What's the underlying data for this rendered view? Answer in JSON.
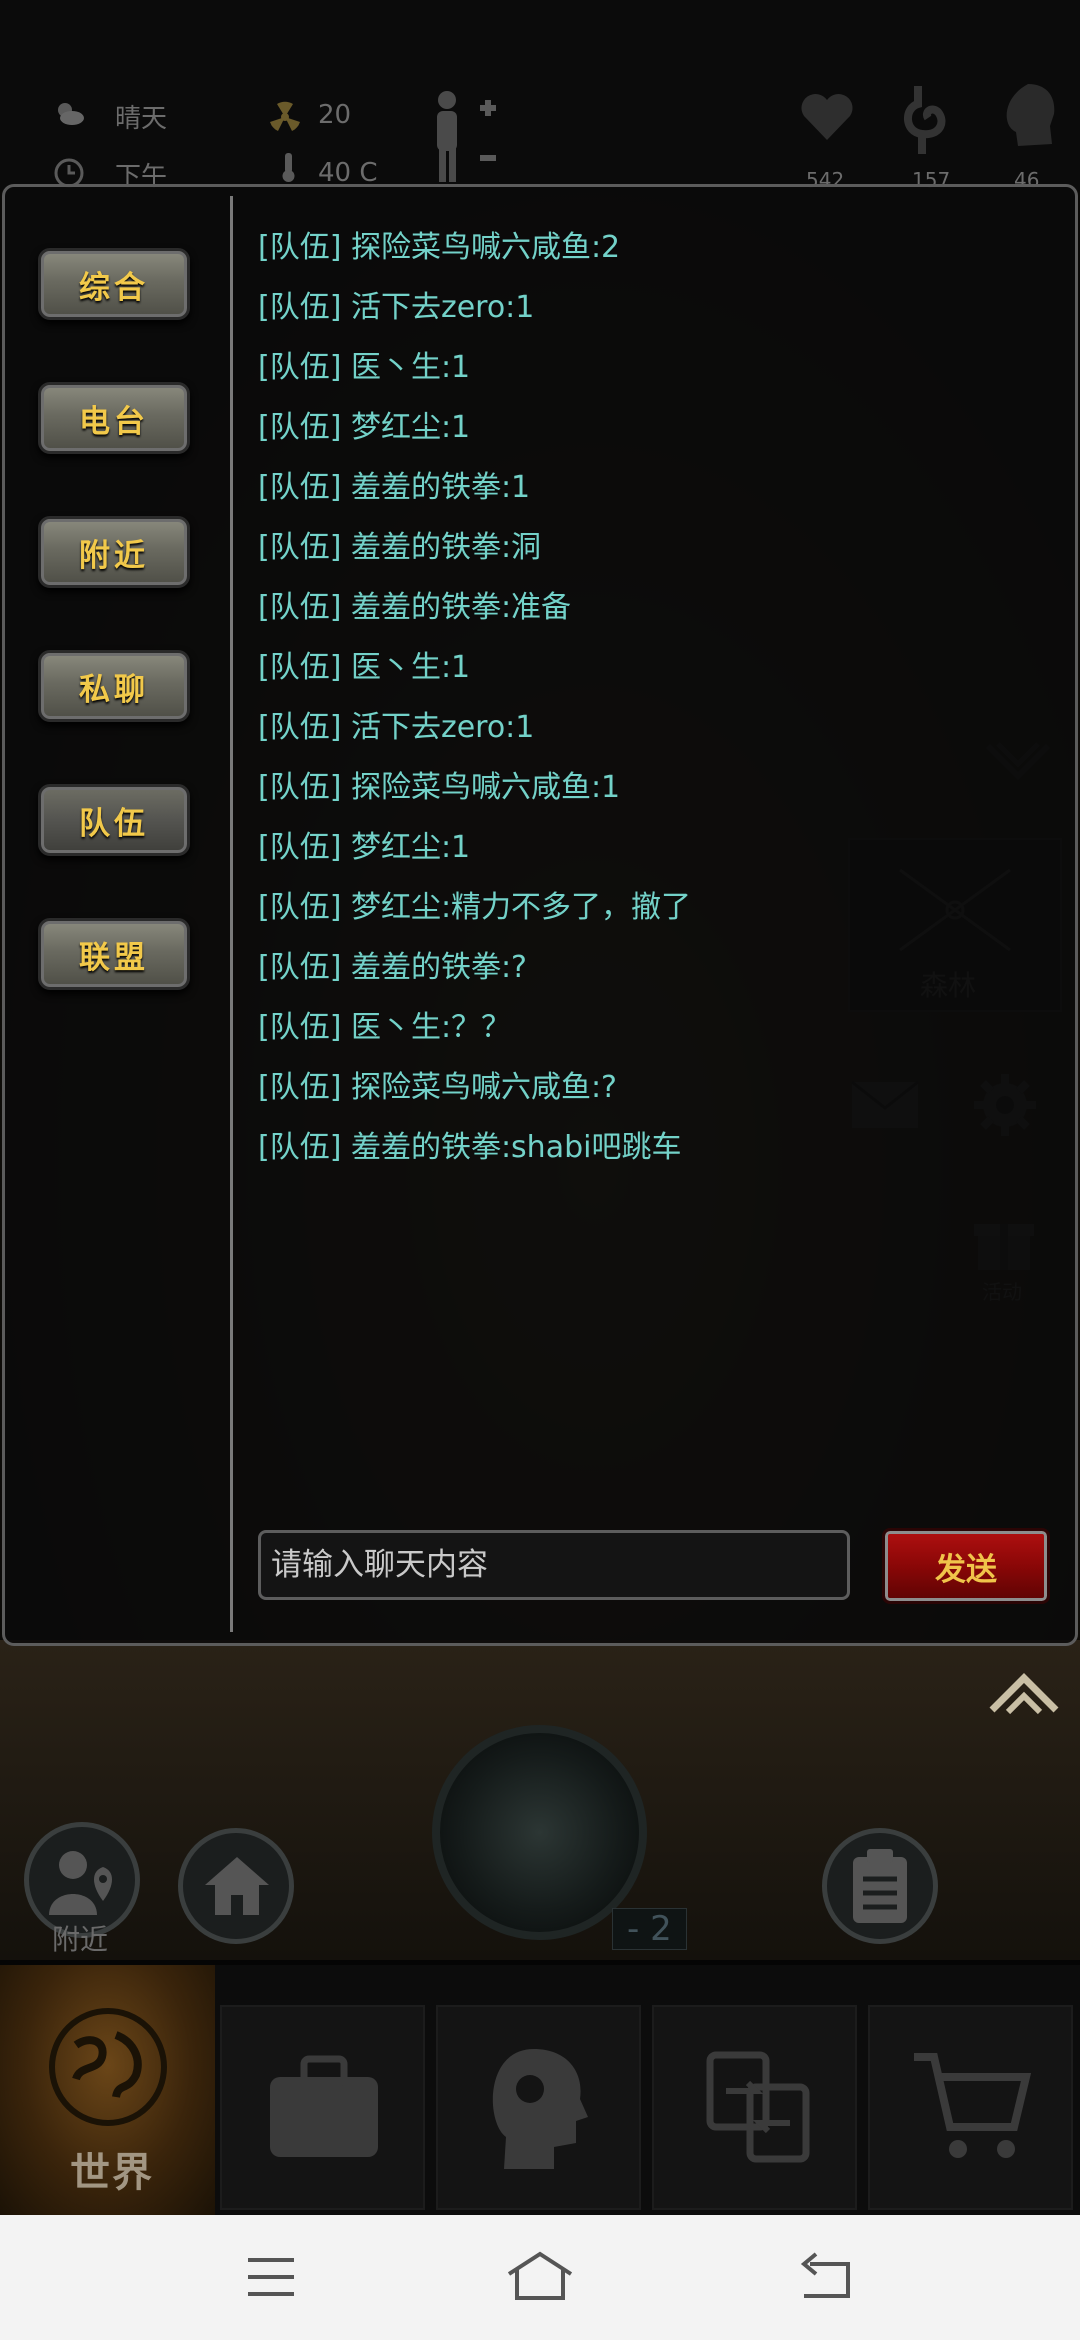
{
  "status": {
    "weather": "晴天",
    "radiation": "20",
    "time_of_day": "下午",
    "temperature": "40 C",
    "health": "542",
    "hunger": "157",
    "thirst": "46"
  },
  "scene": {
    "location_label": "森林",
    "event_label": "活动",
    "nearby_label": "附近",
    "radar_number": "- 2"
  },
  "channels": [
    "综合",
    "电台",
    "附近",
    "私聊",
    "队伍",
    "联盟"
  ],
  "active_channel": "队伍",
  "messages": [
    "[队伍] 探险菜鸟喊六咸鱼:2",
    "[队伍] 活下去zero:1",
    "[队伍] 医丶生:1",
    "[队伍] 梦红尘:1",
    "[队伍] 羞羞的铁拳:1",
    "[队伍] 羞羞的铁拳:洞",
    "[队伍] 羞羞的铁拳:准备",
    "[队伍] 医丶生:1",
    "[队伍] 活下去zero:1",
    "[队伍] 探险菜鸟喊六咸鱼:1",
    "[队伍] 梦红尘:1",
    "[队伍] 梦红尘:精力不多了，撤了",
    "[队伍] 羞羞的铁拳:?",
    "[队伍] 医丶生:？？",
    "[队伍] 探险菜鸟喊六咸鱼:?",
    "[队伍] 羞羞的铁拳:shabi吧跳车"
  ],
  "input": {
    "placeholder": "请输入聊天内容",
    "value": ""
  },
  "send_label": "发送",
  "tabbar": {
    "world_label": "世界"
  },
  "colors": {
    "message_text": "#73d2c9",
    "channel_label": "#f2c94a",
    "send_button": "#8a0707"
  }
}
